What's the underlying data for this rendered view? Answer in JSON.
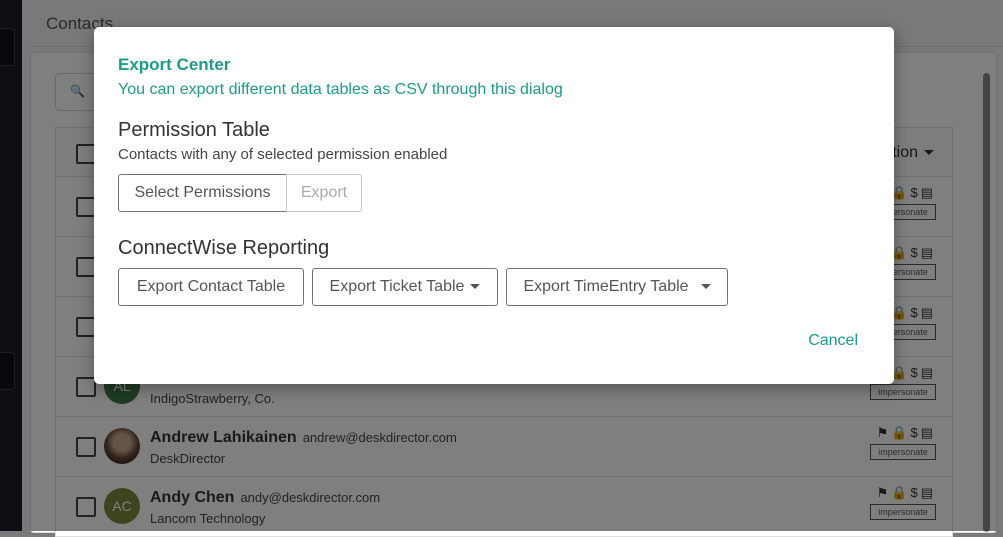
{
  "page": {
    "title": "Contacts",
    "search_icon": "search-icon",
    "table": {
      "header_action": "tion",
      "rows": [
        {
          "initials": "",
          "name": "",
          "email": "",
          "company": "",
          "avatar_color": "#3e7b4b"
        },
        {
          "initials": "",
          "name": "",
          "email": "",
          "company": "",
          "avatar_color": "#3e7b4b"
        },
        {
          "initials": "",
          "name": "",
          "email": "",
          "company": "",
          "avatar_color": "#3e7b4b"
        },
        {
          "initials": "AL",
          "name": "",
          "email": "",
          "company": "IndigoStrawberry, Co.",
          "avatar_color": "#3e7b4b"
        },
        {
          "initials": "",
          "name": "Andrew Lahikainen",
          "email": "andrew@deskdirector.com",
          "company": "DeskDirector",
          "avatar_color": "photo"
        },
        {
          "initials": "AC",
          "name": "Andy Chen",
          "email": "andy@deskdirector.com",
          "company": "Lancom Technology",
          "avatar_color": "#7d8a3c"
        }
      ],
      "impersonate_label": "impersonate",
      "row_icons": [
        "tag-icon",
        "lock-icon",
        "dollar-icon",
        "list-icon"
      ]
    }
  },
  "modal": {
    "title": "Export Center",
    "subtitle": "You can export different data tables as CSV through this dialog",
    "permission": {
      "heading": "Permission Table",
      "description": "Contacts with any of selected permission enabled",
      "select_label": "Select Permissions",
      "export_label": "Export"
    },
    "connectwise": {
      "heading": "ConnectWise Reporting",
      "contact_label": "Export Contact Table",
      "ticket_label": "Export Ticket Table",
      "timeentry_label": "Export TimeEntry Table"
    },
    "cancel_label": "Cancel"
  },
  "colors": {
    "accent": "#1a9c8a",
    "overlay": "rgba(0,0,0,0.5)"
  }
}
